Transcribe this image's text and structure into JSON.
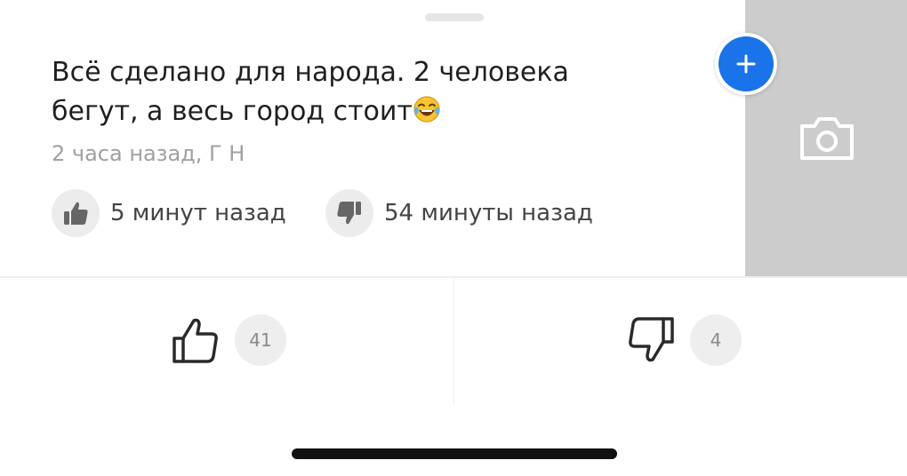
{
  "comment": {
    "text_line1": "Всё сделано для народа. 2 человека",
    "text_line2": "бегут, а весь город стоит",
    "emoji": "face-with-tears-of-joy",
    "meta": "2 часа назад, Г Н"
  },
  "reactions": {
    "like_label": "5 минут назад",
    "dislike_label": "54 минуты назад",
    "like_icon": "thumbs-up-filled-icon",
    "dislike_icon": "thumbs-down-filled-icon"
  },
  "votes": {
    "up_count": "41",
    "down_count": "4",
    "up_icon": "thumbs-up-outline-icon",
    "down_icon": "thumbs-down-outline-icon"
  },
  "side_panel": {
    "add_icon": "plus-icon",
    "camera_icon": "camera-icon",
    "add_color": "#1a73e8",
    "panel_color": "#cccccc"
  }
}
